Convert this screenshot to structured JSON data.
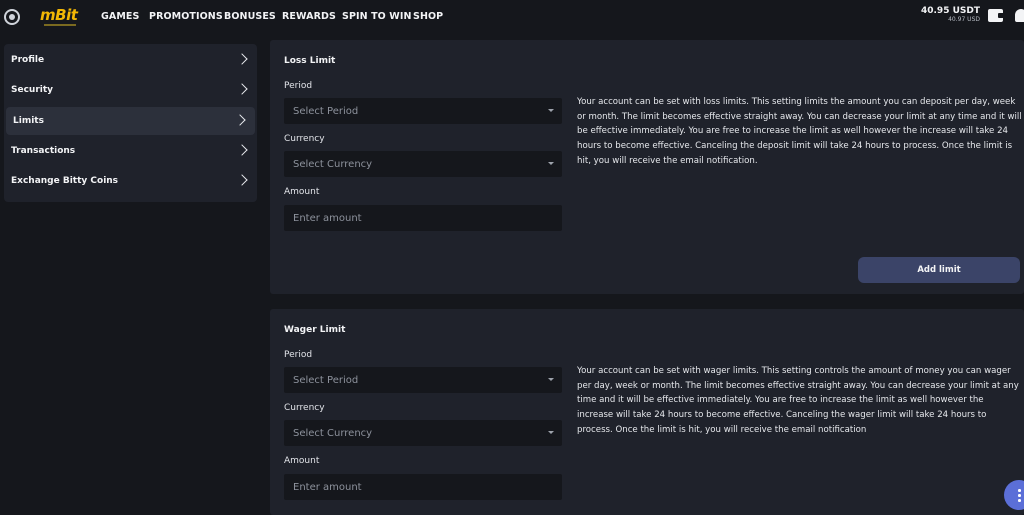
{
  "brand": {
    "name": "mBit"
  },
  "nav": {
    "items": [
      "GAMES",
      "PROMOTIONS",
      "BONUSES",
      "REWARDS",
      "SPIN TO WIN",
      "SHOP"
    ]
  },
  "balance": {
    "main": "40.95 USDT",
    "sub": "40.97 USD"
  },
  "icons": {
    "logo": "mbit-logo-icon",
    "wallet": "wallet-icon",
    "notifications": "bell-icon",
    "chevron": "chevron-right-icon",
    "dropdown": "caret-down-icon",
    "menu": "more-vertical-icon"
  },
  "sidebar": {
    "items": [
      {
        "label": "Profile",
        "active": false
      },
      {
        "label": "Security",
        "active": false
      },
      {
        "label": "Limits",
        "active": true
      },
      {
        "label": "Transactions",
        "active": false
      },
      {
        "label": "Exchange Bitty Coins",
        "active": false
      }
    ]
  },
  "loss_limit": {
    "title": "Loss Limit",
    "period_label": "Period",
    "period_placeholder": "Select Period",
    "currency_label": "Currency",
    "currency_placeholder": "Select Currency",
    "amount_label": "Amount",
    "amount_placeholder": "Enter amount",
    "description": "Your account can be set with loss limits. This setting limits the amount you can deposit per day, week or month. The limit becomes effective straight away. You can decrease your limit at any time and it will be effective immediately. You are free to increase the limit as well however the increase will take 24 hours to become effective. Canceling the deposit limit will take 24 hours to process. Once the limit is hit, you will receive the email notification.",
    "button_label": "Add limit"
  },
  "wager_limit": {
    "title": "Wager Limit",
    "period_label": "Period",
    "period_placeholder": "Select Period",
    "currency_label": "Currency",
    "currency_placeholder": "Select Currency",
    "amount_label": "Amount",
    "amount_placeholder": "Enter amount",
    "description": "Your account can be set with wager limits. This setting controls the amount of money you can wager per day, week or month. The limit becomes effective straight away. You can decrease your limit at any time and it will be effective immediately. You are free to increase the limit as well however the increase will take 24 hours to become effective. Canceling the wager limit will take 24 hours to process. Once the limit is hit, you will receive the email notification"
  },
  "colors": {
    "background": "#15171c",
    "panel": "#1f222b",
    "active_item": "#2c303b",
    "brand": "#f2b705",
    "button": "#3b4468",
    "fab": "#5b6fd8"
  }
}
